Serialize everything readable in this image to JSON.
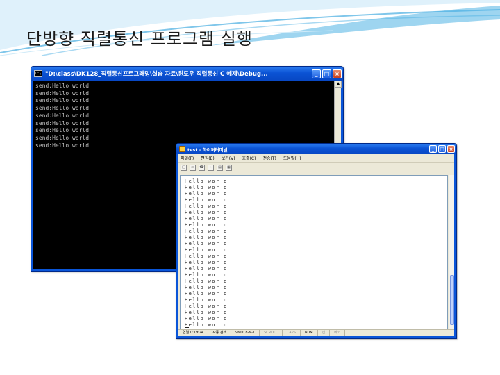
{
  "slide": {
    "title": "단방향 직렬통신 프로그램 실행"
  },
  "console_window": {
    "title": "\"D:\\class\\DK128_직렬통신프로그래밍\\실습 자료\\윈도우 직렬통신 C 예제\\Debug...",
    "icon": "console-app-icon",
    "buttons": {
      "minimize": "_",
      "maximize": "□",
      "close": "×"
    },
    "output_lines": [
      "send:Hello world",
      "send:Hello world",
      "send:Hello world",
      "send:Hello world",
      "send:Hello world",
      "send:Hello world",
      "send:Hello world",
      "send:Hello world",
      "send:Hello world"
    ],
    "colors": {
      "background": "#000000",
      "text": "#c0c0c0"
    }
  },
  "terminal_window": {
    "title": "test - 하이퍼터미널",
    "icon": "hyperterminal-icon",
    "buttons": {
      "minimize": "_",
      "maximize": "□",
      "close": "×"
    },
    "menu": [
      "파일(F)",
      "편집(E)",
      "보기(V)",
      "호출(C)",
      "전송(T)",
      "도움말(H)"
    ],
    "toolbar_icons": [
      "new-icon",
      "open-icon",
      "phone-icon",
      "disconnect-icon",
      "send-icon",
      "properties-icon"
    ],
    "received_lines": [
      "Hello wor d",
      "Hello wor d",
      "Hello wor d",
      "Hello wor d",
      "Hello wor d",
      "Hello wor d",
      "Hello wor d",
      "Hello wor d",
      "Hello wor d",
      "Hello wor d",
      "Hello wor d",
      "Hello wor d",
      "Hello wor d",
      "Hello wor d",
      "Hello wor d",
      "Hello wor d",
      "Hello wor d",
      "Hello wor d",
      "Hello wor d",
      "Hello wor d",
      "Hello wor d",
      "Hello wor d",
      "Hello wor d",
      "Hello wor d"
    ],
    "status": {
      "connected": "연결 0:19:24",
      "detect": "자동 검색",
      "settings": "9600 8-N-1",
      "scroll": "SCROLL",
      "caps": "CAPS",
      "num": "NUM",
      "capture": "캡",
      "echo": "에코"
    }
  }
}
